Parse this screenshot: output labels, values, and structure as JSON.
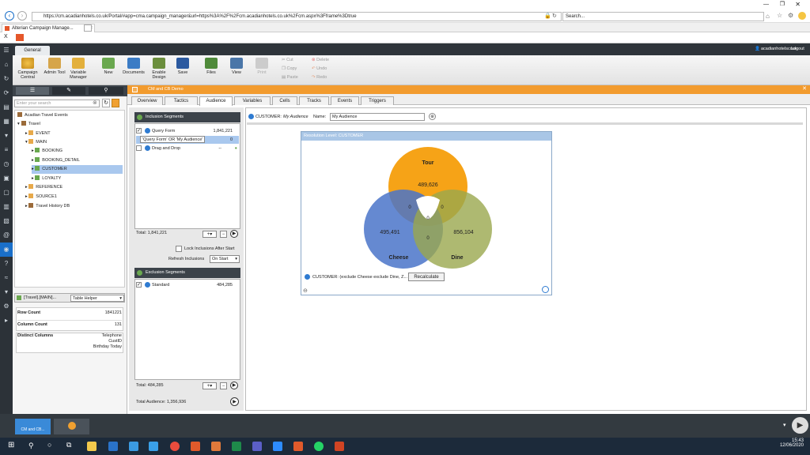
{
  "browser": {
    "url": "https://cm.acadianhotels.co.uk/Portal/#app=cma.campaign_manager&url=https%3A%2F%2Fcm.acadianhotels.co.uk%2Fcm.aspx%3Fframe%3Dtrue",
    "search_placeholder": "Search...",
    "tab_title": "Alterian Campaign Manage...",
    "fav_close": "X"
  },
  "app": {
    "ribbon_tab": "General",
    "user": "acadianhotelscouk",
    "logout": "Logout",
    "ribbon": {
      "campaign_central": "Campaign Central",
      "admin_tool": "Admin Tool",
      "variable_manager": "Variable Manager",
      "new": "New",
      "documents": "Documents",
      "enable_design": "Enable Design",
      "save": "Save",
      "files": "Files",
      "view": "View",
      "print": "Print",
      "cut": "Cut",
      "copy": "Copy",
      "paste": "Paste",
      "delete": "Delete",
      "undo": "Undo",
      "redo": "Redo"
    }
  },
  "left": {
    "search_placeholder": "Enter your search",
    "tree": [
      {
        "label": "Acadian Travel Events"
      },
      {
        "label": "Travel"
      },
      {
        "label": "EVENT"
      },
      {
        "label": "MAIN"
      },
      {
        "label": "BOOKING"
      },
      {
        "label": "BOOKING_DETAIL"
      },
      {
        "label": "CUSTOMER"
      },
      {
        "label": "LOYALTY"
      },
      {
        "label": "REFERENCE"
      },
      {
        "label": "SOURCE1"
      },
      {
        "label": "Travel History DB"
      }
    ],
    "path": "[Travel].[MAIN]...",
    "helper": "Table Helper",
    "row_count_label": "Row Count",
    "row_count": "1841221",
    "column_count_label": "Column Count",
    "column_count": "131",
    "distinct_label": "Distinct Columns",
    "distinct": [
      "Telephone",
      "CustID",
      "Birthday Today"
    ]
  },
  "center": {
    "title": "CM and CB Demo",
    "tabs": [
      "Overview",
      "Tactics",
      "Audience",
      "Variables",
      "Cells",
      "Tracks",
      "Events",
      "Triggers"
    ]
  },
  "segments": {
    "inclusion_title": "Inclusion Segments",
    "inclusion": [
      {
        "name": "Query Form",
        "count": "1,841,221"
      },
      {
        "name": "'Query Form' OR 'My Audience'",
        "count": "0"
      },
      {
        "name": "Drag and Drop",
        "count": "--"
      }
    ],
    "inclusion_total": "Total: 1,841,221",
    "lock_label": "Lock Inclusions After Start",
    "refresh_label": "Refresh Inclusions",
    "refresh_value": "On Start",
    "exclusion_title": "Exclusion Segments",
    "exclusion": [
      {
        "name": "Standard",
        "count": "484,285"
      }
    ],
    "exclusion_total": "Total: 484,285",
    "total_audience": "Total Audience: 1,356,936"
  },
  "audience": {
    "customer_label": "CUSTOMER:",
    "audience_italic": "My Audience",
    "name_label": "Name:",
    "name_value": "My Audience",
    "resolution": "Resolution Level: CUSTOMER",
    "footer": "CUSTOMER: (exclude Cheese exclude Dine, Z...",
    "recalculate": "Recalculate"
  },
  "venn": {
    "sets": [
      {
        "name": "Tour",
        "value": "489,626",
        "color": "#f59e0b"
      },
      {
        "name": "Cheese",
        "value": "495,491",
        "color": "#4a74c9"
      },
      {
        "name": "Dine",
        "value": "856,104",
        "color": "#9aa84d"
      }
    ],
    "intersections": {
      "tour_cheese": "0",
      "tour_dine": "0",
      "cheese_dine": "0",
      "all": "0"
    }
  },
  "taskbar": {
    "app_btn": "CM and CB...",
    "time": "15:43",
    "date": "12/06/2020"
  }
}
